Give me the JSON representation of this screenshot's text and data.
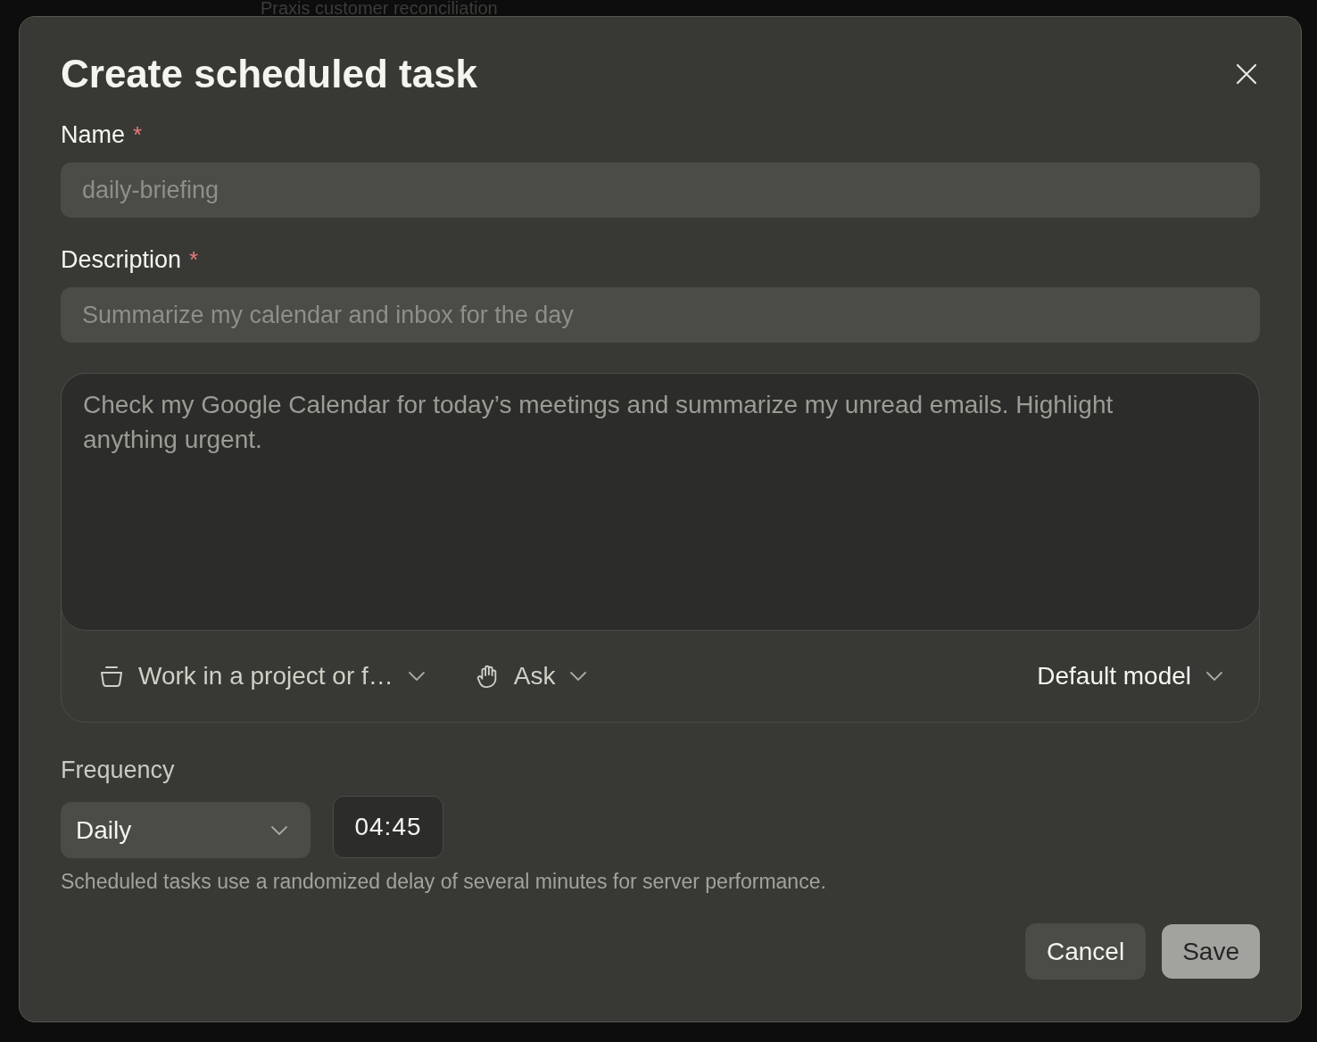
{
  "background": {
    "page_text": "Praxis customer reconciliation"
  },
  "dialog": {
    "title": "Create scheduled task",
    "fields": [
      {
        "label": "Name",
        "required_mark": "*",
        "placeholder": "daily-briefing"
      },
      {
        "label": "Description",
        "required_mark": "*",
        "placeholder": "Summarize my calendar and inbox for the day"
      }
    ],
    "prompt": {
      "placeholder": "Check my Google Calendar for today’s meetings and summarize my unread emails. Highlight anything urgent.",
      "toolbar": [
        {
          "kind": "folder",
          "label": "Work in a project or f…"
        },
        {
          "kind": "permission",
          "label": "Ask"
        },
        {
          "kind": "model",
          "label": "Default model"
        }
      ]
    },
    "frequency": {
      "label": "Frequency",
      "select": {
        "value": "Daily"
      },
      "time": {
        "value": "04:45"
      },
      "hint": "Scheduled tasks use a randomized delay of several minutes for server performance."
    },
    "buttons": [
      {
        "kind": "secondary",
        "label": "Cancel"
      },
      {
        "kind": "primary",
        "label": "Save"
      }
    ]
  }
}
